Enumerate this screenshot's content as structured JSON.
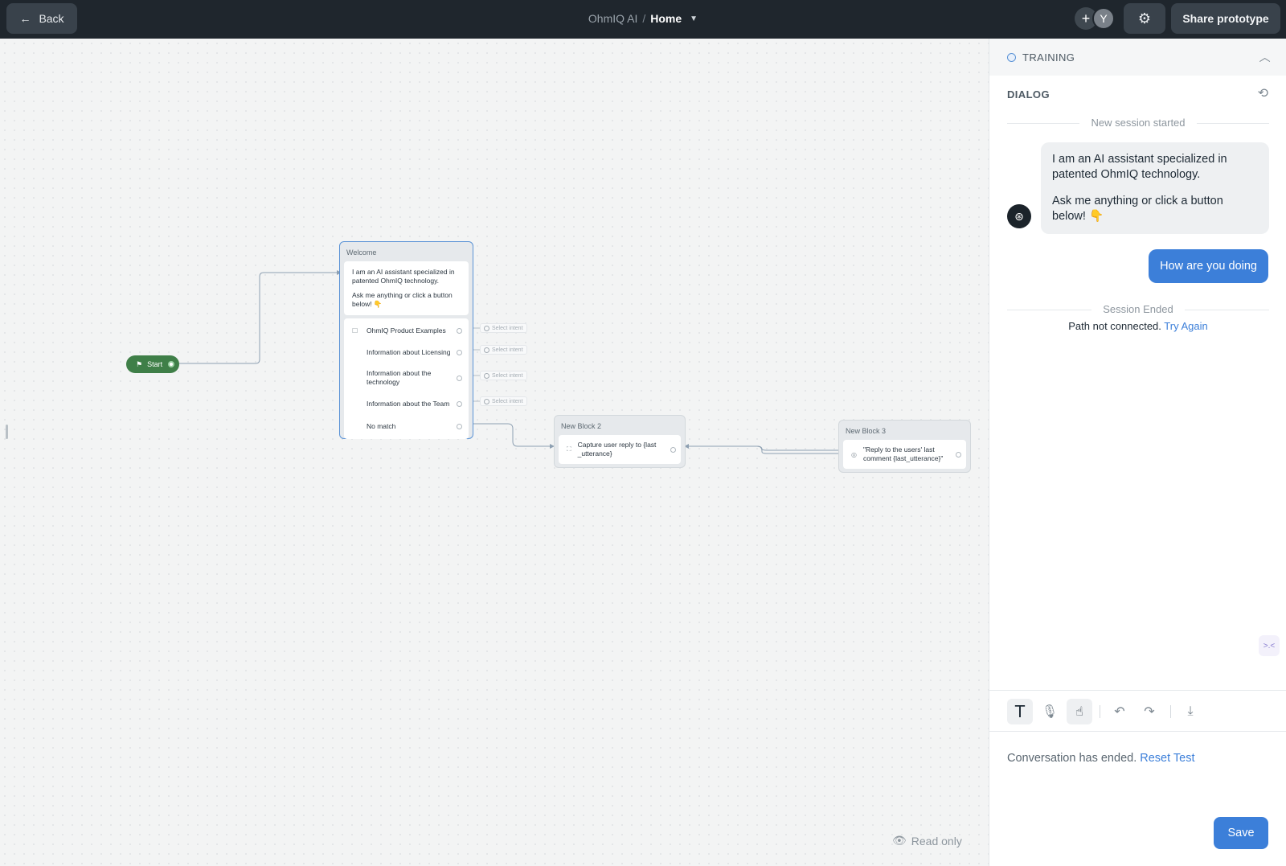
{
  "topbar": {
    "back_label": "Back",
    "project_name": "OhmIQ AI",
    "separator": "/",
    "current_page": "Home",
    "avatar_add": "+",
    "avatar_initial": "Y",
    "share_label": "Share prototype"
  },
  "canvas": {
    "start_label": "Start",
    "read_only_label": "Read only",
    "welcome_block": {
      "title": "Welcome",
      "message_line1": "I am an AI assistant specialized in patented OhmIQ technology.",
      "message_line2": "Ask me anything or click a button below! 👇",
      "choices": [
        {
          "label": "OhmIQ Product Examples"
        },
        {
          "label": "Information about Licensing"
        },
        {
          "label": "Information about the technology"
        },
        {
          "label": "Information about the Team"
        },
        {
          "label": "No match"
        }
      ],
      "intent_placeholder": "Select intent"
    },
    "block2": {
      "title": "New Block 2",
      "step_text": "Capture user reply to {last_utterance}"
    },
    "block3": {
      "title": "New Block 3",
      "step_text": "\"Reply to the users' last comment {last_utterance}\""
    }
  },
  "panel": {
    "training_label": "TRAINING",
    "dialog_label": "DIALOG",
    "session_started": "New session started",
    "bot_message_1": "I am an AI assistant specialized in patented OhmIQ technology.",
    "bot_message_2": "Ask me anything or click a button below! 👇",
    "user_message": "How are you doing",
    "session_ended": "Session Ended",
    "path_not_connected": "Path not connected.",
    "try_again": "Try Again",
    "conversation_ended": "Conversation has ended.",
    "reset_test": "Reset Test",
    "save_label": "Save",
    "text_mode_glyph": "T"
  },
  "colors": {
    "topbar_bg": "#1f262d",
    "accent": "#3c7fd9",
    "start_green": "#3f7f48"
  },
  "icons": [
    "arrow-left-icon",
    "chevron-down-icon",
    "gear-icon",
    "eye-icon",
    "refresh-icon",
    "chevron-up-icon",
    "microphone-icon",
    "pointer-icon",
    "undo-icon",
    "redo-icon",
    "download-icon"
  ]
}
